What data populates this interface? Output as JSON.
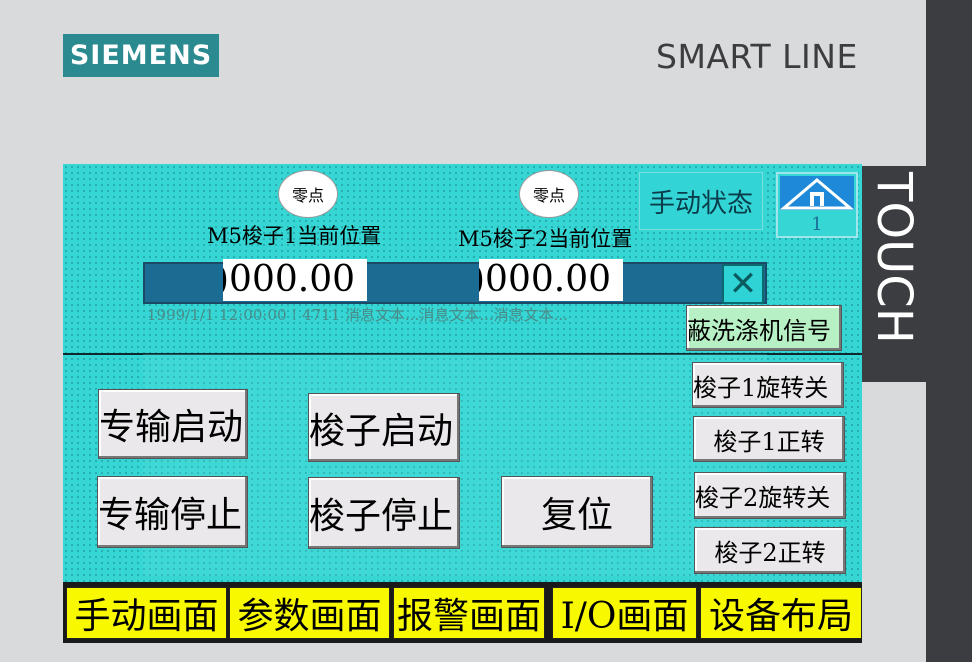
{
  "device": {
    "brand": "SIEMENS",
    "model": "SMART LINE",
    "side_label": "TOUCH"
  },
  "header": {
    "manual_status_label": "手动状态",
    "home_number": "1"
  },
  "positions": [
    {
      "zero_label": "零点",
      "label": "M5梭子1当前位置",
      "value": ")000.00"
    },
    {
      "zero_label": "零点",
      "label": "M5梭子2当前位置",
      "value": ")000.00"
    }
  ],
  "message_bar": {
    "close_symbol": "✕",
    "text": "1999/1/1 12:00:00 ! 4711 消息文本...消息文本...消息文本..."
  },
  "main_buttons": [
    "专输启动",
    "梭子启动",
    "专输停止",
    "梭子停止",
    "复位"
  ],
  "side_buttons": [
    "蔽洗涤机信号",
    "梭子1旋转关",
    "梭子1正转",
    "梭子2旋转关",
    "梭子2正转"
  ],
  "nav": [
    "手动画面",
    "参数画面",
    "报警画面",
    "I/O画面",
    "设备布局"
  ],
  "colors": {
    "screen_bg": "#35d6d4",
    "nav_button": "#f8f800",
    "brand_teal": "#2a8a8f",
    "message_bar": "#1b6b92"
  }
}
